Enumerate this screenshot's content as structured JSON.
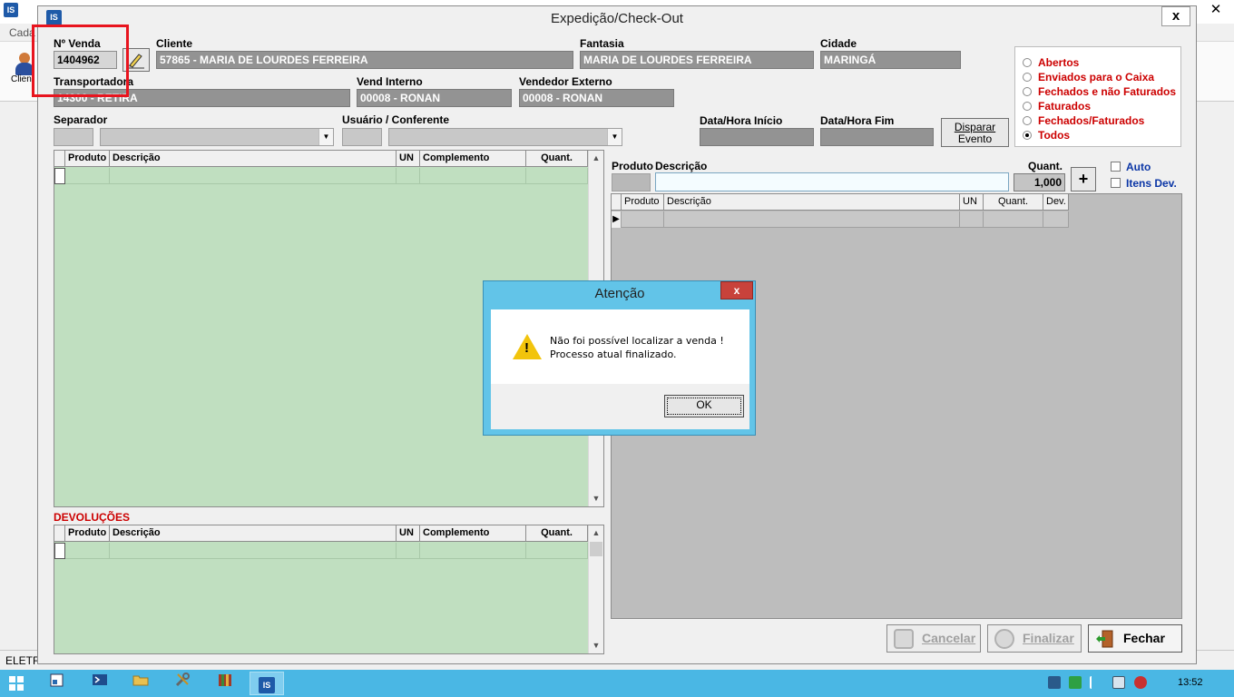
{
  "background": {
    "menu_label": "Cada",
    "toolbar_label": "Clien",
    "status_label": "ELETF"
  },
  "window": {
    "title": "Expedição/Check-Out",
    "close": "x"
  },
  "form": {
    "venda_label": "Nº Venda",
    "venda_value": "1404962",
    "cliente_label": "Cliente",
    "cliente_value": "57865 - MARIA DE LOURDES FERREIRA",
    "fantasia_label": "Fantasia",
    "fantasia_value": "MARIA DE LOURDES FERREIRA",
    "cidade_label": "Cidade",
    "cidade_value": "MARINGÁ",
    "transportadora_label": "Transportadora",
    "transportadora_value": "14300 - RETIRA",
    "vend_interno_label": "Vend Interno",
    "vend_interno_value": "00008 - RONAN",
    "vendedor_externo_label": "Vendedor Externo",
    "vendedor_externo_value": "00008 - RONAN",
    "separador_label": "Separador",
    "usuario_label": "Usuário / Conferente",
    "data_inicio_label": "Data/Hora Início",
    "data_fim_label": "Data/Hora Fim",
    "disparar_line1": "Disparar",
    "disparar_line2": "Evento"
  },
  "filters": [
    {
      "label": "Abertos",
      "selected": false
    },
    {
      "label": "Enviados para o Caixa",
      "selected": false
    },
    {
      "label": "Fechados e não Faturados",
      "selected": false
    },
    {
      "label": "Faturados",
      "selected": false
    },
    {
      "label": "Fechados/Faturados",
      "selected": false
    },
    {
      "label": "Todos",
      "selected": true
    }
  ],
  "items_grid": {
    "columns": [
      "Produto",
      "Descrição",
      "UN",
      "Complemento",
      "Quant."
    ]
  },
  "devolucoes": {
    "title": "DEVOLUÇÕES",
    "columns": [
      "Produto",
      "Descrição",
      "UN",
      "Complemento",
      "Quant."
    ]
  },
  "entry": {
    "produto_label": "Produto",
    "descricao_label": "Descrição",
    "quant_label": "Quant.",
    "quant_value": "1,000",
    "add_label": "+",
    "auto_label": "Auto",
    "itens_dev_label": "Itens Dev."
  },
  "check_grid": {
    "columns": [
      "Produto",
      "Descrição",
      "UN",
      "Quant.",
      "Dev."
    ]
  },
  "buttons": {
    "cancelar": "Cancelar",
    "finalizar": "Finalizar",
    "fechar": "Fechar"
  },
  "dialog": {
    "title": "Atenção",
    "close": "x",
    "line1": "Não foi possível localizar a venda !",
    "line2": "Processo atual finalizado.",
    "ok": "OK"
  },
  "taskbar": {
    "time": "13:52",
    "app_label": "IS"
  },
  "colors": {
    "accent_red": "#cc0000",
    "highlight_box": "#e8141e",
    "taskbar": "#4ab7e4",
    "grid_green": "#c0dfc0"
  }
}
